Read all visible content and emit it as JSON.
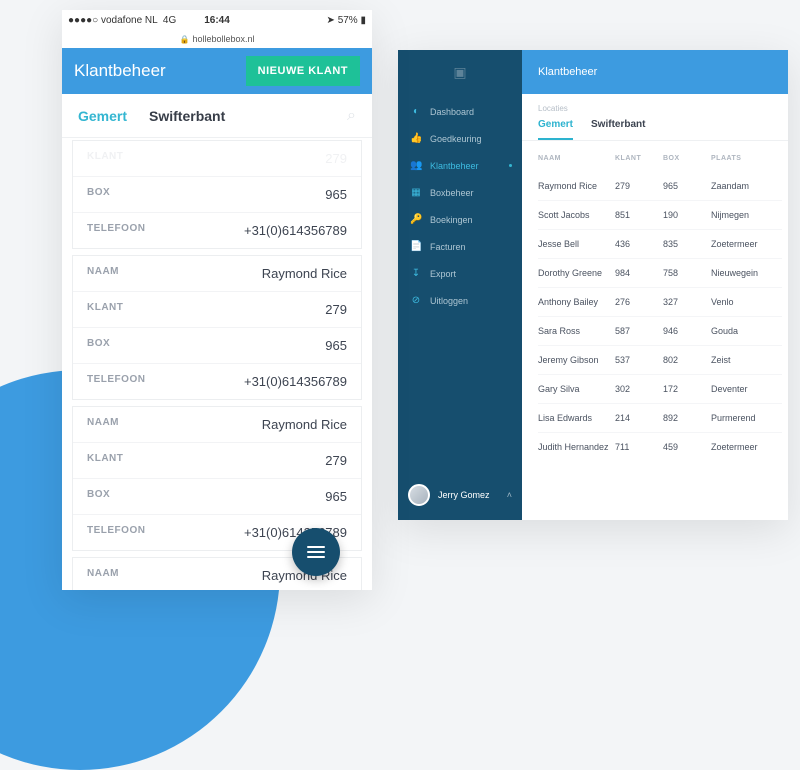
{
  "mobile": {
    "statusbar": {
      "carrier": "vodafone NL",
      "network": "4G",
      "time": "16:44",
      "battery": "57%"
    },
    "url": "hollebollebox.nl",
    "header_title": "Klantbeheer",
    "new_button": "NIEUWE KLANT",
    "tabs": {
      "active": "Gemert",
      "other": "Swifterbant"
    },
    "search_placeholder": "Zoeken",
    "first_partial": {
      "klant": "279",
      "box": "965",
      "telefoon": "+31(0)614356789",
      "klant_label": "KLANT",
      "box_label": "BOX",
      "tel_label": "TELEFOON"
    },
    "card": {
      "naam_label": "NAAM",
      "naam": "Raymond Rice",
      "klant_label": "KLANT",
      "klant": "279",
      "box_label": "BOX",
      "box": "965",
      "tel_label": "TELEFOON",
      "tel": "+31(0)614356789"
    },
    "last_partial": {
      "naam_label": "NAAM",
      "naam": "Raymond Rice"
    }
  },
  "desktop": {
    "sidebar": {
      "items": [
        {
          "icon": "◐",
          "label": "Dashboard"
        },
        {
          "icon": "👍",
          "label": "Goedkeuring"
        },
        {
          "icon": "👥",
          "label": "Klantbeheer",
          "active": true
        },
        {
          "icon": "▦",
          "label": "Boxbeheer"
        },
        {
          "icon": "🔑",
          "label": "Boekingen"
        },
        {
          "icon": "📄",
          "label": "Facturen"
        },
        {
          "icon": "↧",
          "label": "Export"
        },
        {
          "icon": "⊘",
          "label": "Uitloggen"
        }
      ],
      "user": "Jerry Gomez"
    },
    "header_title": "Klantbeheer",
    "sublabel": "Locaties",
    "tabs": {
      "active": "Gemert",
      "other": "Swifterbant"
    },
    "columns": [
      "NAAM",
      "KLANT",
      "BOX",
      "PLAATS"
    ],
    "rows": [
      {
        "naam": "Raymond Rice",
        "klant": "279",
        "box": "965",
        "plaats": "Zaandam"
      },
      {
        "naam": "Scott Jacobs",
        "klant": "851",
        "box": "190",
        "plaats": "Nijmegen"
      },
      {
        "naam": "Jesse Bell",
        "klant": "436",
        "box": "835",
        "plaats": "Zoetermeer"
      },
      {
        "naam": "Dorothy Greene",
        "klant": "984",
        "box": "758",
        "plaats": "Nieuwegein"
      },
      {
        "naam": "Anthony Bailey",
        "klant": "276",
        "box": "327",
        "plaats": "Venlo"
      },
      {
        "naam": "Sara Ross",
        "klant": "587",
        "box": "946",
        "plaats": "Gouda"
      },
      {
        "naam": "Jeremy Gibson",
        "klant": "537",
        "box": "802",
        "plaats": "Zeist"
      },
      {
        "naam": "Gary Silva",
        "klant": "302",
        "box": "172",
        "plaats": "Deventer"
      },
      {
        "naam": "Lisa Edwards",
        "klant": "214",
        "box": "892",
        "plaats": "Purmerend"
      },
      {
        "naam": "Judith Hernandez",
        "klant": "711",
        "box": "459",
        "plaats": "Zoetermeer"
      }
    ]
  }
}
